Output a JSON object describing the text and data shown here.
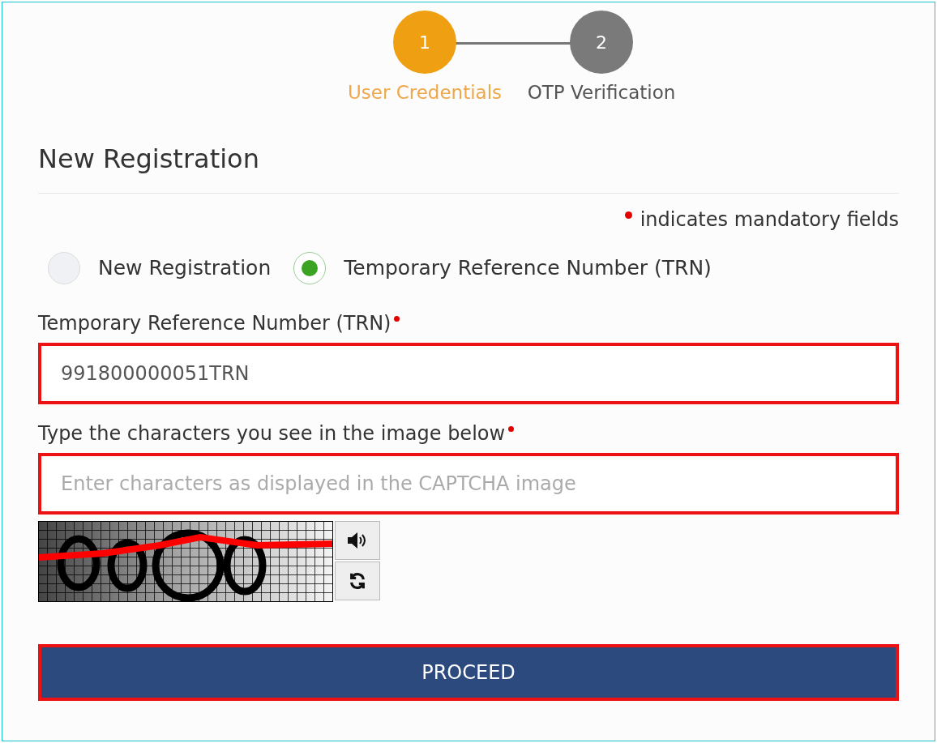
{
  "stepper": {
    "steps": [
      {
        "number": "1",
        "label": "User Credentials",
        "selected": true
      },
      {
        "number": "2",
        "label": "OTP Verification",
        "selected": false
      }
    ]
  },
  "title": "New Registration",
  "mandatory_note": "indicates mandatory fields",
  "radios": [
    {
      "label": "New Registration",
      "selected": false
    },
    {
      "label": "Temporary Reference Number (TRN)",
      "selected": true
    }
  ],
  "trn_field": {
    "label": "Temporary Reference Number (TRN)",
    "required": true,
    "value": "991800000051TRN",
    "highlighted": true
  },
  "captcha_field": {
    "label": "Type the characters you see in the image below",
    "required": true,
    "placeholder": "Enter characters as displayed in the CAPTCHA image",
    "highlighted": true
  },
  "proceed_button": {
    "label": "PROCEED",
    "highlighted": true
  }
}
